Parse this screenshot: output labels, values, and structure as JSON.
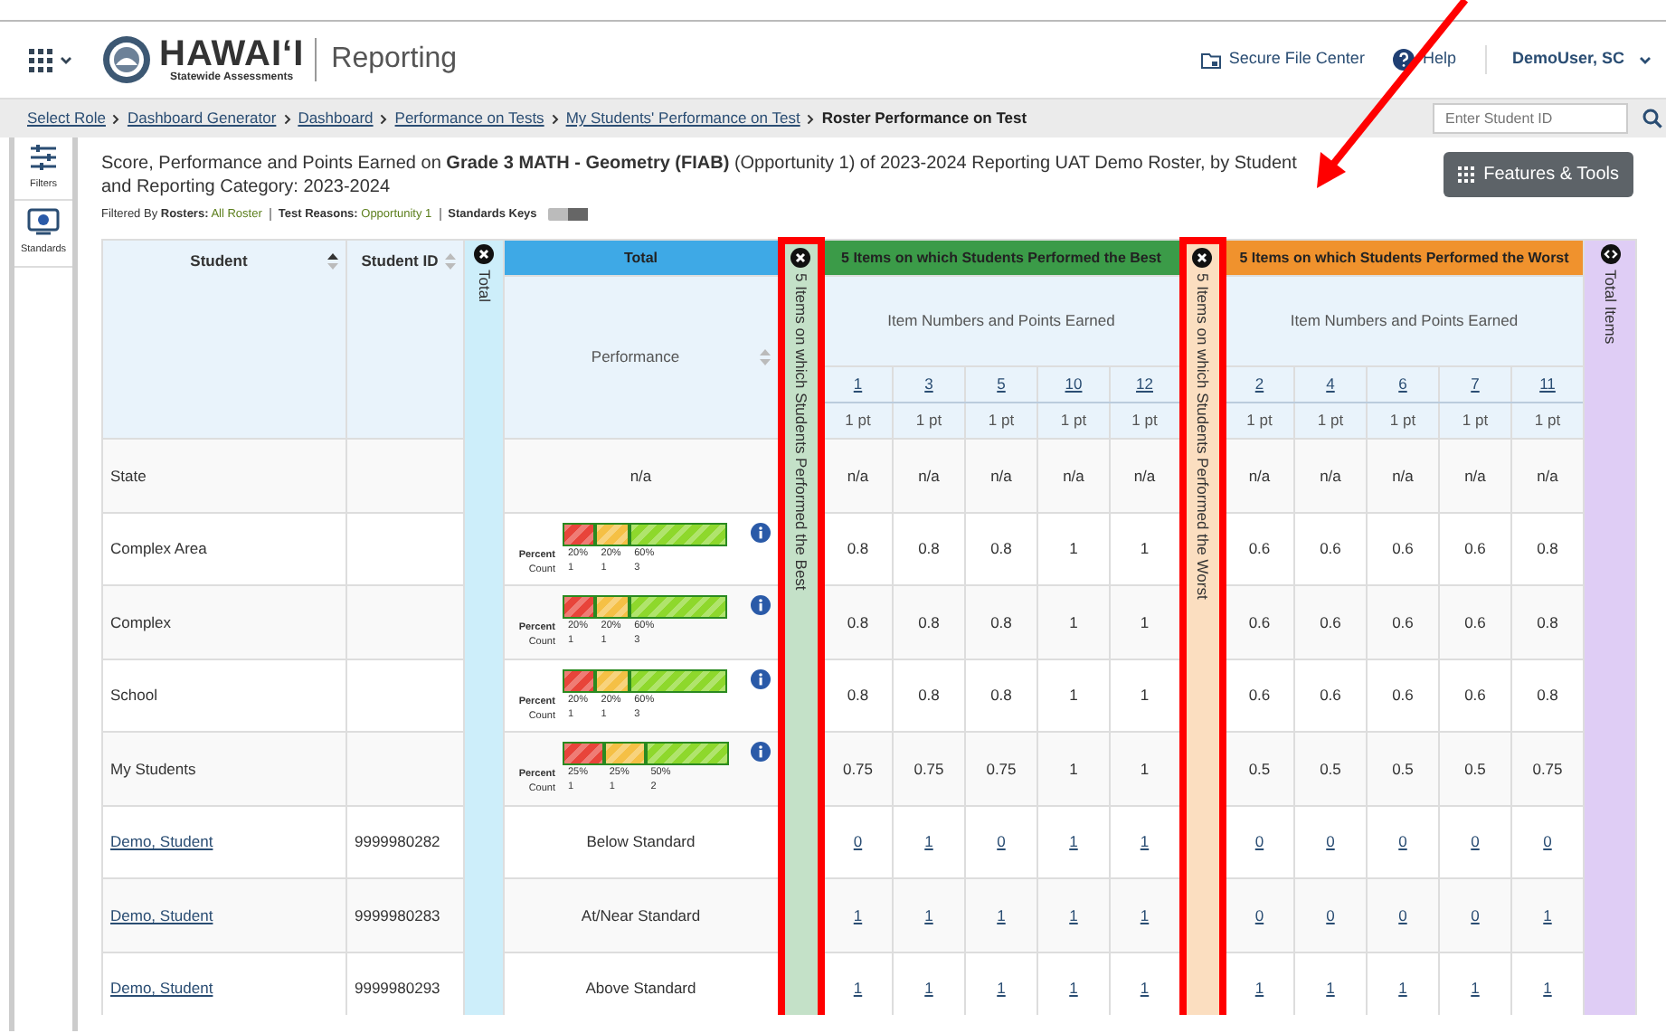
{
  "header": {
    "logo_title": "HAWAI‘I",
    "logo_subtitle": "Statewide Assessments",
    "app_name": "Reporting",
    "links": [
      {
        "label": "Secure File Center",
        "kind": "folder"
      },
      {
        "label": "Help",
        "kind": "help"
      }
    ],
    "user": "DemoUser, SC"
  },
  "breadcrumbs": [
    {
      "label": "Select Role",
      "link": true
    },
    {
      "label": "Dashboard Generator",
      "link": true
    },
    {
      "label": "Dashboard",
      "link": true
    },
    {
      "label": "Performance on Tests",
      "link": true
    },
    {
      "label": "My Students' Performance on Test",
      "link": true
    },
    {
      "label": "Roster Performance on Test",
      "link": false
    }
  ],
  "student_search": {
    "placeholder": "Enter Student ID"
  },
  "sidebar": [
    {
      "label": "Filters",
      "kind": "filters"
    },
    {
      "label": "Standards",
      "kind": "standards"
    }
  ],
  "report": {
    "title": "Score, Performance and Points Earned on **Grade 3 MATH - Geometry (FIAB)** (Opportunity 1) of 2023-2024 Reporting UAT Demo Roster, by Student and Reporting Category: 2023-2024",
    "filtered_by": "Filtered By",
    "filters": [
      {
        "label": "Rosters:",
        "value": "All Roster"
      },
      {
        "label": "Test Reasons:",
        "value": "Opportunity 1"
      }
    ],
    "standards_keys": {
      "label": "Standards Keys",
      "on": false
    },
    "tools_button": "Features & Tools"
  },
  "table": {
    "columns": [
      {
        "label": "Student",
        "sorted": true
      },
      {
        "label": "Student ID",
        "sorted": false
      }
    ],
    "total_group": {
      "collapsed_label": "Total",
      "header": "Total",
      "subheader": "Performance",
      "highlighted": false
    },
    "item_groups": [
      {
        "collapsed_label": "5 Items on which Students Performed the Best",
        "header": "5 Items on which Students Performed the Best",
        "subheader": "Item Numbers and Points Earned",
        "color": "#3b9b48",
        "highlighted": true,
        "items": [
          {
            "number": "1",
            "points": "1 pt"
          },
          {
            "number": "3",
            "points": "1 pt"
          },
          {
            "number": "5",
            "points": "1 pt"
          },
          {
            "number": "10",
            "points": "1 pt"
          },
          {
            "number": "12",
            "points": "1 pt"
          }
        ]
      },
      {
        "collapsed_label": "5 Items on which Students Performed the Worst",
        "header": "5 Items on which Students Performed the Worst",
        "subheader": "Item Numbers and Points Earned",
        "color": "#f0922d",
        "highlighted": true,
        "items": [
          {
            "number": "2",
            "points": "1 pt"
          },
          {
            "number": "4",
            "points": "1 pt"
          },
          {
            "number": "6",
            "points": "1 pt"
          },
          {
            "number": "7",
            "points": "1 pt"
          },
          {
            "number": "11",
            "points": "1 pt"
          }
        ]
      }
    ],
    "total_items": {
      "collapsed_label": "Total Items",
      "highlighted": false
    },
    "rows": [
      {
        "name": "State",
        "link": false,
        "performance": {
          "kind": "text",
          "text": "n/a"
        },
        "best": [
          "n/a",
          "n/a",
          "n/a",
          "n/a",
          "n/a"
        ],
        "worst": [
          "n/a",
          "n/a",
          "n/a",
          "n/a",
          "n/a"
        ]
      },
      {
        "name": "Complex Area",
        "link": false,
        "performance": {
          "kind": "bar",
          "percent_label": "Percent",
          "count_label": "Count",
          "segments": [
            {
              "percent": "20%",
              "count": "1",
              "color": "#e8443a"
            },
            {
              "percent": "20%",
              "count": "1",
              "color": "#f5c045"
            },
            {
              "percent": "60%",
              "count": "3",
              "color": "#8ed82c"
            }
          ]
        },
        "best": [
          "0.8",
          "0.8",
          "0.8",
          "1",
          "1"
        ],
        "worst": [
          "0.6",
          "0.6",
          "0.6",
          "0.6",
          "0.8"
        ]
      },
      {
        "name": "Complex",
        "link": false,
        "performance": {
          "kind": "bar",
          "percent_label": "Percent",
          "count_label": "Count",
          "segments": [
            {
              "percent": "20%",
              "count": "1",
              "color": "#e8443a"
            },
            {
              "percent": "20%",
              "count": "1",
              "color": "#f5c045"
            },
            {
              "percent": "60%",
              "count": "3",
              "color": "#8ed82c"
            }
          ]
        },
        "best": [
          "0.8",
          "0.8",
          "0.8",
          "1",
          "1"
        ],
        "worst": [
          "0.6",
          "0.6",
          "0.6",
          "0.6",
          "0.8"
        ]
      },
      {
        "name": "School",
        "link": false,
        "performance": {
          "kind": "bar",
          "percent_label": "Percent",
          "count_label": "Count",
          "segments": [
            {
              "percent": "20%",
              "count": "1",
              "color": "#e8443a"
            },
            {
              "percent": "20%",
              "count": "1",
              "color": "#f5c045"
            },
            {
              "percent": "60%",
              "count": "3",
              "color": "#8ed82c"
            }
          ]
        },
        "best": [
          "0.8",
          "0.8",
          "0.8",
          "1",
          "1"
        ],
        "worst": [
          "0.6",
          "0.6",
          "0.6",
          "0.6",
          "0.8"
        ]
      },
      {
        "name": "My Students",
        "link": false,
        "performance": {
          "kind": "bar",
          "percent_label": "Percent",
          "count_label": "Count",
          "segments": [
            {
              "percent": "25%",
              "count": "1",
              "color": "#e8443a"
            },
            {
              "percent": "25%",
              "count": "1",
              "color": "#f5c045"
            },
            {
              "percent": "50%",
              "count": "2",
              "color": "#8ed82c"
            }
          ]
        },
        "best": [
          "0.75",
          "0.75",
          "0.75",
          "1",
          "1"
        ],
        "worst": [
          "0.5",
          "0.5",
          "0.5",
          "0.5",
          "0.75"
        ]
      },
      {
        "name": "Demo, Student",
        "link": true,
        "student_id": "9999980282",
        "performance": {
          "kind": "text",
          "text": "Below Standard"
        },
        "best": [
          "0",
          "1",
          "0",
          "1",
          "1"
        ],
        "worst": [
          "0",
          "0",
          "0",
          "0",
          "0"
        ]
      },
      {
        "name": "Demo, Student",
        "link": true,
        "student_id": "9999980283",
        "performance": {
          "kind": "text",
          "text": "At/Near Standard"
        },
        "best": [
          "1",
          "1",
          "1",
          "1",
          "1"
        ],
        "worst": [
          "0",
          "0",
          "0",
          "0",
          "1"
        ]
      },
      {
        "name": "Demo, Student",
        "link": true,
        "student_id": "9999980293",
        "performance": {
          "kind": "text",
          "text": "Above Standard"
        },
        "best": [
          "1",
          "1",
          "1",
          "1",
          "1"
        ],
        "worst": [
          "1",
          "1",
          "1",
          "1",
          "1"
        ]
      }
    ]
  }
}
